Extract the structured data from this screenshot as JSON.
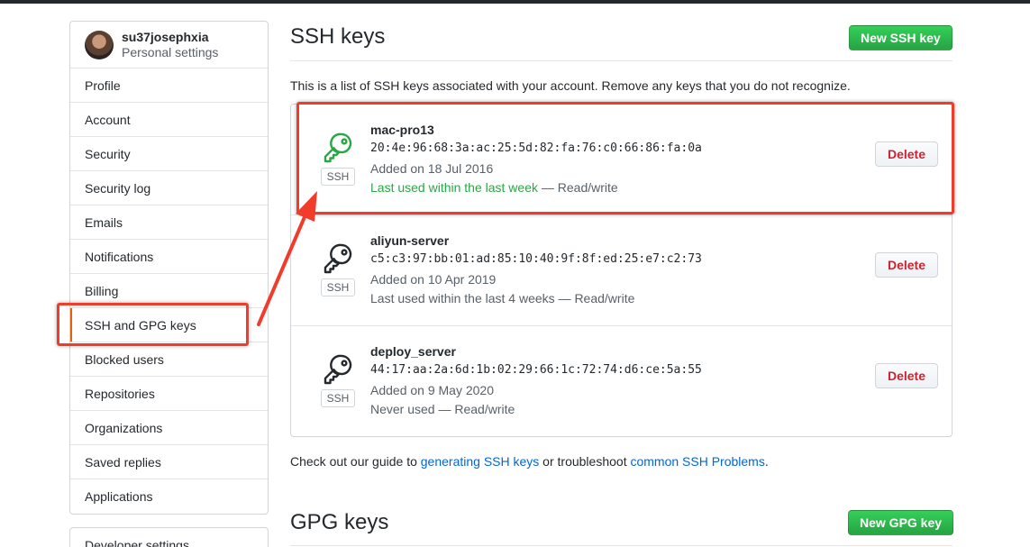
{
  "sidebar": {
    "username": "su37josephxia",
    "subtitle": "Personal settings",
    "items": [
      {
        "label": "Profile"
      },
      {
        "label": "Account"
      },
      {
        "label": "Security"
      },
      {
        "label": "Security log"
      },
      {
        "label": "Emails"
      },
      {
        "label": "Notifications"
      },
      {
        "label": "Billing"
      },
      {
        "label": "SSH and GPG keys"
      },
      {
        "label": "Blocked users"
      },
      {
        "label": "Repositories"
      },
      {
        "label": "Organizations"
      },
      {
        "label": "Saved replies"
      },
      {
        "label": "Applications"
      }
    ],
    "developer_settings": "Developer settings"
  },
  "ssh": {
    "title": "SSH keys",
    "new_button": "New SSH key",
    "intro": "This is a list of SSH keys associated with your account. Remove any keys that you do not recognize.",
    "keys": [
      {
        "name": "mac-pro13",
        "fingerprint": "20:4e:96:68:3a:ac:25:5d:82:fa:76:c0:66:86:fa:0a",
        "added": "Added on 18 Jul 2016",
        "last_used": "Last used within the last week",
        "access": " — Read/write",
        "tag": "SSH",
        "delete": "Delete",
        "icon": "key-icon",
        "icon_color": "#28a745"
      },
      {
        "name": "aliyun-server",
        "fingerprint": "c5:c3:97:bb:01:ad:85:10:40:9f:8f:ed:25:e7:c2:73",
        "added": "Added on 10 Apr 2019",
        "last_used": "Last used within the last 4 weeks",
        "access": " — Read/write",
        "tag": "SSH",
        "delete": "Delete",
        "icon": "key-icon",
        "icon_color": "#24292e"
      },
      {
        "name": "deploy_server",
        "fingerprint": "44:17:aa:2a:6d:1b:02:29:66:1c:72:74:d6:ce:5a:55",
        "added": "Added on 9 May 2020",
        "last_used": "Never used",
        "access": " — Read/write",
        "tag": "SSH",
        "delete": "Delete",
        "icon": "key-icon",
        "icon_color": "#24292e"
      }
    ],
    "guide_prefix": "Check out our guide to ",
    "guide_link1": "generating SSH keys",
    "guide_middle": " or troubleshoot ",
    "guide_link2": "common SSH Problems",
    "guide_suffix": "."
  },
  "gpg": {
    "title": "GPG keys",
    "new_button": "New GPG key"
  },
  "colors": {
    "annotation": "#f23c2b",
    "primary_button": "#28a745",
    "link": "#0366d6",
    "danger": "#cb2431"
  }
}
